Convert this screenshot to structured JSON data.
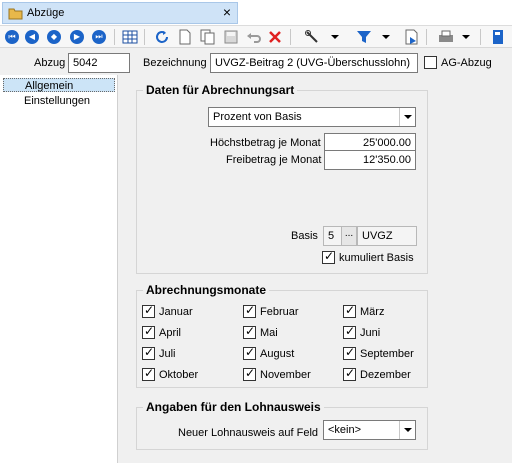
{
  "window": {
    "title": "Abzüge",
    "close_label": "×"
  },
  "toolbar": {
    "icons": [
      "first-record-icon",
      "previous-record-icon",
      "find-record-icon",
      "next-record-icon",
      "last-record-icon",
      "table-view-icon",
      "refresh-icon",
      "new-document-icon",
      "copy-icon",
      "save-icon",
      "undo-icon",
      "delete-icon",
      "tools-icon",
      "filter-icon",
      "export-icon",
      "print-icon",
      "book-icon"
    ]
  },
  "header": {
    "abzug_label": "Abzug",
    "abzug_value": "5042",
    "bezeichnung_label": "Bezeichnung",
    "bezeichnung_value": "UVGZ-Beitrag 2 (UVG-Überschusslohn)",
    "ag_abzug_label": "AG-Abzug",
    "ag_abzug_checked": false
  },
  "sidebar": {
    "items": [
      {
        "label": "Allgemein",
        "selected": true
      },
      {
        "label": "Einstellungen",
        "selected": false
      }
    ]
  },
  "abrechnungsart": {
    "title": "Daten für Abrechnungsart",
    "type_value": "Prozent von Basis",
    "hoechstbetrag_label": "Höchstbetrag je Monat",
    "hoechstbetrag_value": "25'000.00",
    "freibetrag_label": "Freibetrag je Monat",
    "freibetrag_value": "12'350.00",
    "basis_label": "Basis",
    "basis_number": "5",
    "basis_button": "...",
    "basis_name": "UVGZ",
    "kumuliert_label": "kumuliert Basis",
    "kumuliert_checked": true
  },
  "monate": {
    "title": "Abrechnungsmonate",
    "months": [
      {
        "label": "Januar",
        "checked": true
      },
      {
        "label": "Februar",
        "checked": true
      },
      {
        "label": "März",
        "checked": true
      },
      {
        "label": "April",
        "checked": true
      },
      {
        "label": "Mai",
        "checked": true
      },
      {
        "label": "Juni",
        "checked": true
      },
      {
        "label": "Juli",
        "checked": true
      },
      {
        "label": "August",
        "checked": true
      },
      {
        "label": "September",
        "checked": true
      },
      {
        "label": "Oktober",
        "checked": true
      },
      {
        "label": "November",
        "checked": true
      },
      {
        "label": "Dezember",
        "checked": true
      }
    ]
  },
  "lohnausweis": {
    "title": "Angaben für den Lohnausweis",
    "feld_label": "Neuer Lohnausweis auf Feld",
    "feld_value": "<kein>"
  },
  "colors": {
    "accent": "#1c64c8",
    "selection": "#cce4f7",
    "delete": "#e02020"
  }
}
